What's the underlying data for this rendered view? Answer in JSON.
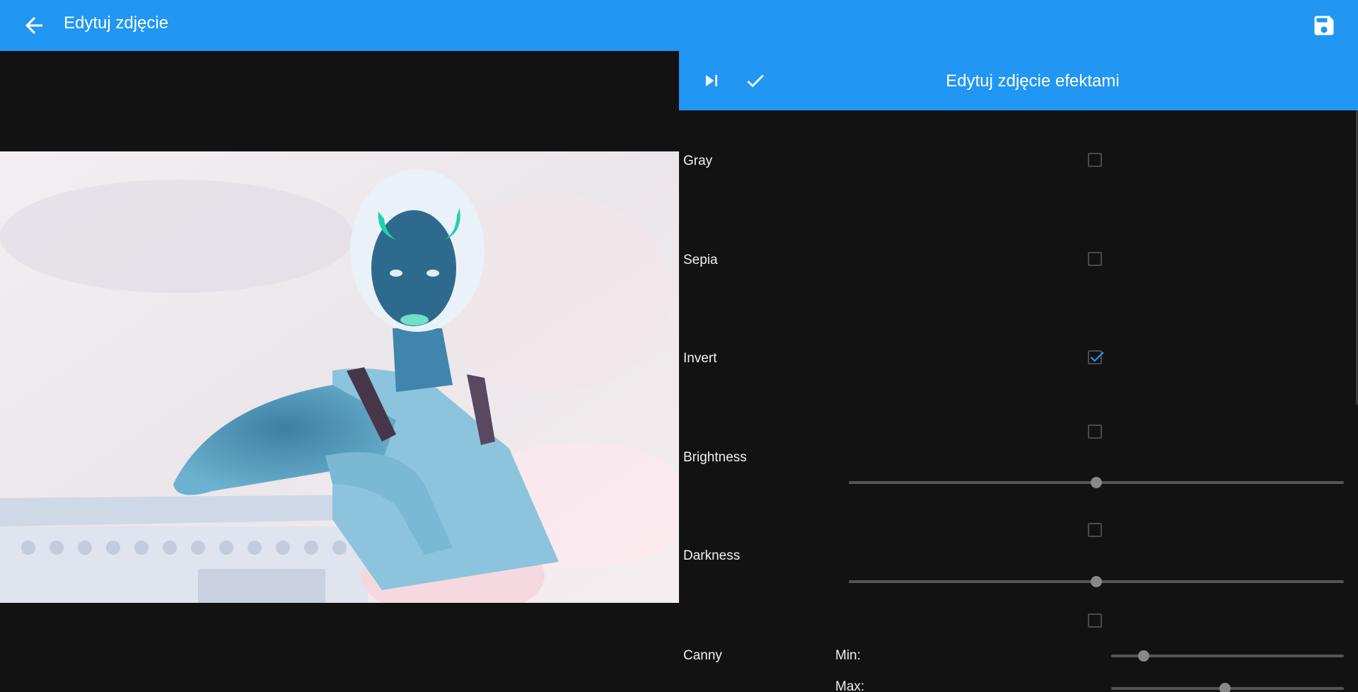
{
  "appbar": {
    "title": "Edytuj zdjęcie"
  },
  "panel": {
    "title": "Edytuj zdjęcie efektami"
  },
  "effects": {
    "gray": {
      "label": "Gray",
      "checked": false
    },
    "sepia": {
      "label": "Sepia",
      "checked": false
    },
    "invert": {
      "label": "Invert",
      "checked": true
    },
    "brightness": {
      "label": "Brightness",
      "checked": false,
      "value": 0.5
    },
    "darkness": {
      "label": "Darkness",
      "checked": false,
      "value": 0.5
    },
    "canny": {
      "label": "Canny",
      "checked": false,
      "min_label": "Min:",
      "max_label": "Max:",
      "min_value": 0.14,
      "max_value": 0.49
    }
  },
  "colors": {
    "primary": "#2196f3",
    "background": "#121212",
    "checkmark": "#2196f3"
  },
  "icons": {
    "back": "arrow-left-icon",
    "save": "floppy-disk-icon",
    "skip": "skip-previous-icon",
    "apply": "check-icon"
  }
}
